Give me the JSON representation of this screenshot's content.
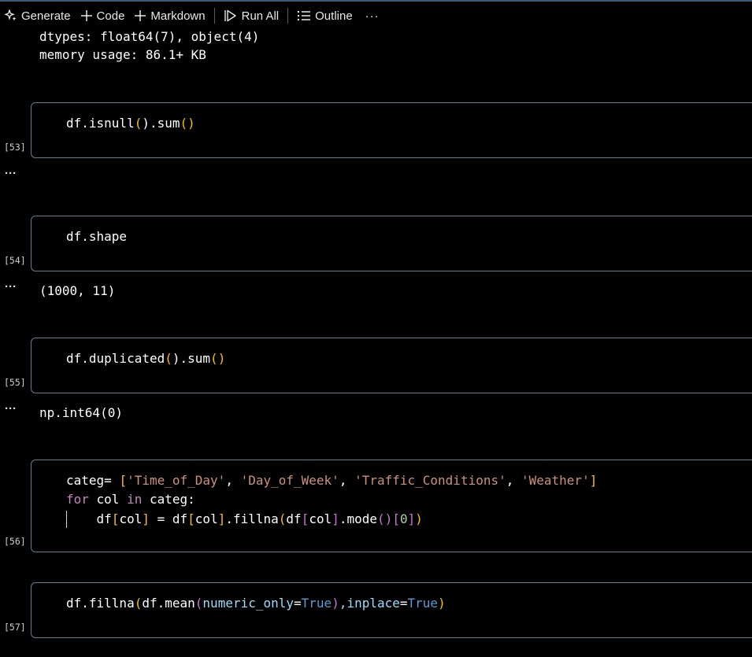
{
  "toolbar": {
    "generate_label": "Generate",
    "code_label": "Code",
    "markdown_label": "Markdown",
    "run_all_label": "Run All",
    "outline_label": "Outline",
    "more_label": "···"
  },
  "previous_output": {
    "line1": "dtypes: float64(7), object(4)",
    "line2": "memory usage: 86.1+ KB"
  },
  "cells": {
    "c53": {
      "count": "[53]",
      "tokens": [
        "df.isnull",
        "(",
        ").sum",
        "(",
        ")"
      ],
      "output_dots": "···"
    },
    "c54": {
      "count": "[54]",
      "code": "df.shape",
      "output_dots": "···",
      "output": "(1000, 11)"
    },
    "c55": {
      "count": "[55]",
      "tokens": [
        "df.duplicated",
        "(",
        ").sum",
        "(",
        ")"
      ],
      "output_dots": "···",
      "output": "np.int64(0)"
    },
    "c56": {
      "count": "[56]",
      "line1": {
        "tokens": [
          "categ= ",
          "[",
          "'Time_of_Day'",
          ", ",
          "'Day_of_Week'",
          ", ",
          "'Traffic_Conditions'",
          ", ",
          "'Weather'",
          "]"
        ]
      },
      "line2": {
        "tokens": [
          "for",
          " col ",
          "in",
          " categ:"
        ]
      },
      "line3": {
        "tokens": [
          "    df",
          "[",
          "col",
          "]",
          " = df",
          "[",
          "col",
          "]",
          ".fillna",
          "(",
          "df",
          "[",
          "col",
          "]",
          ".mode",
          "(",
          ")",
          "[",
          "0",
          "]",
          ")"
        ]
      }
    },
    "c57": {
      "count": "[57]",
      "tokens": [
        "df.fillna",
        "(",
        "df.mean",
        "(",
        "numeric_only",
        "=",
        "True",
        ")",
        ",inplace",
        "=",
        "True",
        ")"
      ]
    }
  },
  "colors": {
    "bracket_level1": "#f4c20d",
    "bracket_level2": "#d16fd6",
    "bracket_level3": "#5aa9f0",
    "string": "#ce9178",
    "keyword": "#c586c0",
    "constant": "#569cd6",
    "cell_border": "#5d7f8f"
  }
}
